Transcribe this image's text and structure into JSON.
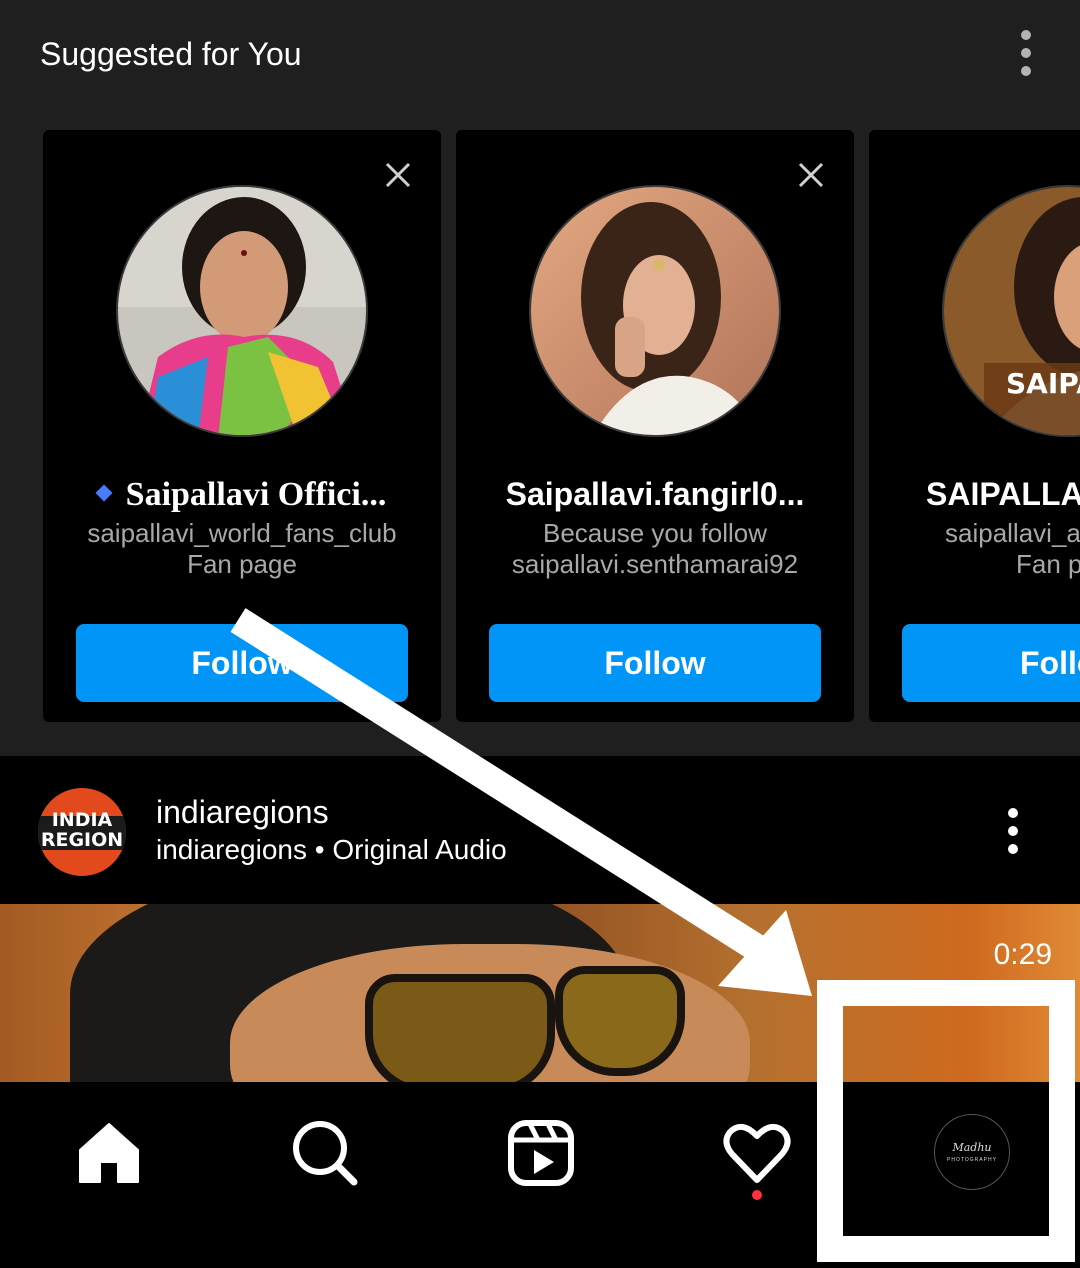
{
  "suggested": {
    "title": "Suggested for You",
    "more_icon": "vertical-ellipsis-icon",
    "cards": [
      {
        "name": "Saipallavi Offici...",
        "sub_line1": "saipallavi_world_fans_club",
        "sub_line2": "Fan page",
        "follow_label": "Follow",
        "verified": true
      },
      {
        "name": "Saipallavi.fangirl0...",
        "sub_line1": "Because you follow",
        "sub_line2": "saipallavi.senthamarai92",
        "follow_label": "Follow",
        "verified": false
      },
      {
        "name": "SAIPALLAV",
        "sub_line1": "saipallavi_ad",
        "sub_line2": "Fan p",
        "follow_label": "Follo",
        "verified": false,
        "avatar_text": "SAIPAL"
      }
    ]
  },
  "post": {
    "avatar_text_line1": "INDIA",
    "avatar_text_line2": "REGION",
    "username": "indiaregions",
    "subtitle": "indiaregions • Original Audio",
    "timer": "0:29"
  },
  "bottom_nav": {
    "items": [
      "home-icon",
      "search-icon",
      "reels-icon",
      "heart-icon",
      "profile-avatar"
    ],
    "profile_logo_line1": "Madhu",
    "profile_logo_line2": "PHOTOGRAPHY"
  },
  "colors": {
    "follow_button": "#0095f6",
    "section_bg": "#1f1f1f",
    "card_bg": "#000000",
    "notification_dot": "#ff3040"
  }
}
